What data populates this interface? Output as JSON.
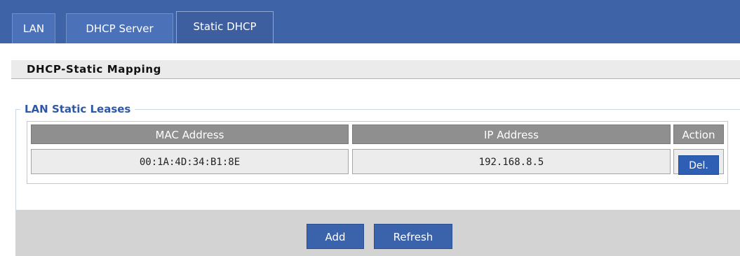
{
  "tabs": [
    {
      "label": "LAN",
      "active": false
    },
    {
      "label": "DHCP Server",
      "active": false
    },
    {
      "label": "Static DHCP",
      "active": true
    }
  ],
  "section": {
    "title": "DHCP-Static Mapping"
  },
  "leases": {
    "legend": "LAN Static Leases",
    "columns": [
      "MAC Address",
      "IP Address",
      "Action"
    ],
    "rows": [
      {
        "mac": "00:1A:4D:34:B1:8E",
        "ip": "192.168.8.5",
        "action_label": "Del."
      }
    ]
  },
  "footer": {
    "add_label": "Add",
    "refresh_label": "Refresh"
  },
  "colors": {
    "accent": "#3e63a6",
    "legend_text": "#2f57a6",
    "header_cell": "#8f8f8f"
  }
}
